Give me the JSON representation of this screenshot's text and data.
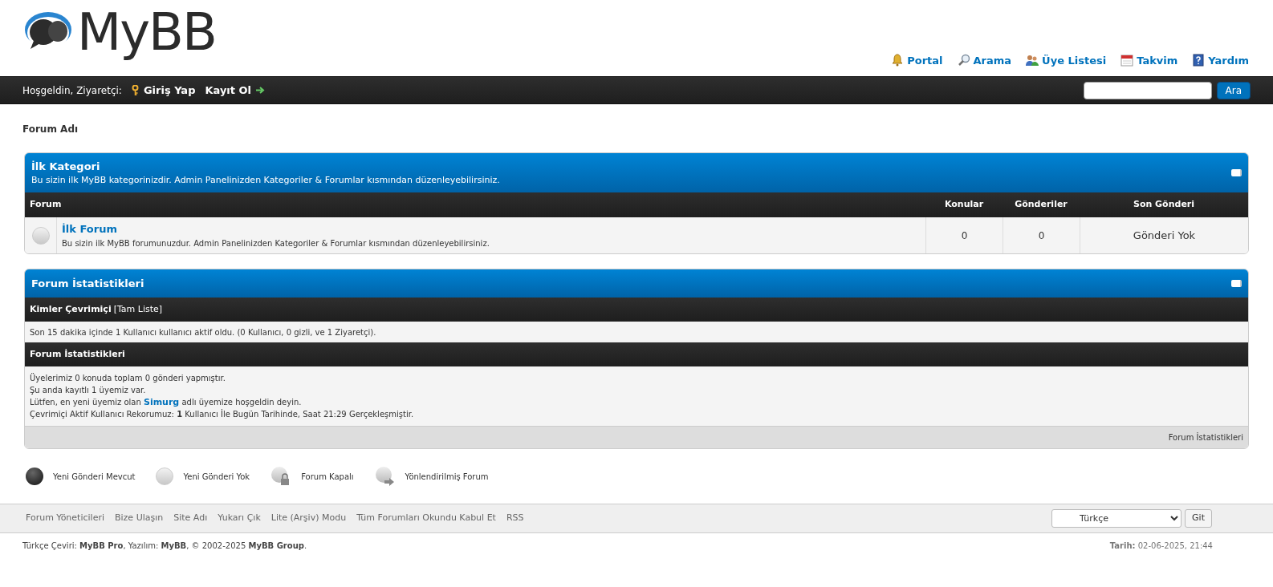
{
  "logo": {
    "text": "MyBB"
  },
  "top_links": [
    {
      "kind": "bell",
      "label": "Portal"
    },
    {
      "kind": "search",
      "label": "Arama"
    },
    {
      "kind": "members",
      "label": "Üye Listesi"
    },
    {
      "kind": "calendar",
      "label": "Takvim"
    },
    {
      "kind": "help",
      "label": "Yardım"
    }
  ],
  "welcome_bar": {
    "greeting": "Hoşgeldin, Ziyaretçi:",
    "login": "Giriş Yap",
    "register": "Kayıt Ol",
    "search_button": "Ara"
  },
  "breadcrumb": "Forum Adı",
  "category": {
    "title": "İlk Kategori",
    "description": "Bu sizin ilk MyBB kategorinizdir. Admin Panelinizden Kategoriler & Forumlar kısmından düzenleyebilirsiniz.",
    "columns": [
      "Forum",
      "Konular",
      "Gönderiler",
      "Son Gönderi"
    ],
    "forums": [
      {
        "name": "İlk Forum",
        "description": "Bu sizin ilk MyBB forumunuzdur. Admin Panelinizden Kategoriler & Forumlar kısmından düzenleyebilirsiniz.",
        "topics": "0",
        "posts": "0",
        "last_post": "Gönderi Yok",
        "new_posts": false
      }
    ]
  },
  "stats": {
    "title": "Forum İstatistikleri",
    "online_heading": "Kimler Çevrimiçi",
    "online_link": "[Tam Liste]",
    "online_text": "Son 15 dakika içinde 1 Kullanıcı kullanıcı aktif oldu. (0 Kullanıcı, 0 gizli, ve 1 Ziyaretçi).",
    "stats_heading": "Forum İstatistikleri",
    "lines": [
      {
        "kind": "text",
        "text": "Üyelerimiz 0 konuda toplam 0 gönderi yapmıştır."
      },
      {
        "kind": "text",
        "text": "Şu anda kayıtlı 1 üyemiz var."
      },
      {
        "kind": "link",
        "before": "Lütfen, en yeni üyemiz olan ",
        "link": "Simurg",
        "after": " adlı üyemize hoşgeldin deyin."
      },
      {
        "kind": "text",
        "text": "Çevrimiçi Aktif Kullanıcı Rekorumuz: **1** Kullanıcı İle Bugün Tarihinde, Saat 21:29 Gerçekleşmiştir."
      }
    ],
    "footer": "Forum İstatistikleri"
  },
  "legend": [
    {
      "kind": "new",
      "label": "Yeni Gönderi Mevcut"
    },
    {
      "kind": "none",
      "label": "Yeni Gönderi Yok"
    },
    {
      "kind": "locked",
      "label": "Forum Kapalı"
    },
    {
      "kind": "redirect",
      "label": "Yönlendirilmiş Forum"
    }
  ],
  "footer_links": [
    "Forum Yöneticileri",
    "Bize Ulaşın",
    "Site Adı",
    "Yukarı Çık",
    "Lite (Arşiv) Modu",
    "Tüm Forumları Okundu Kabul Et",
    "RSS"
  ],
  "language": {
    "value": "Türkçe",
    "button": "Git"
  },
  "copyright": "Türkçe Çeviri: **MyBB Pro**, Yazılım: **MyBB**, © 2002-2025 **MyBB Group**.",
  "date": "**Tarih:** 02-06-2025, 21:44"
}
